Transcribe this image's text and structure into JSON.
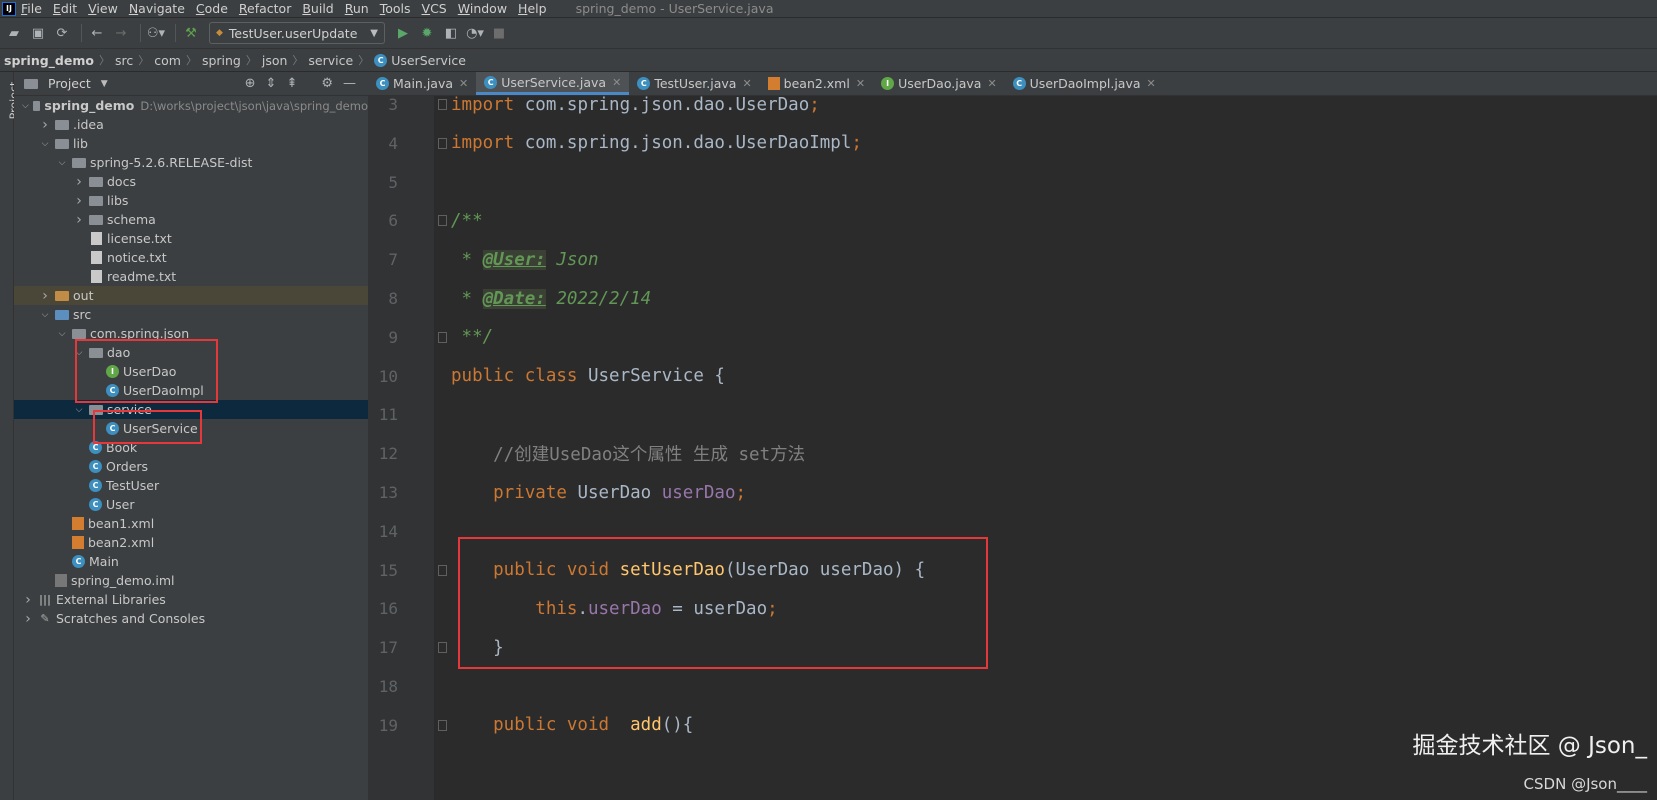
{
  "menubar": {
    "logo": "IJ",
    "items": [
      "File",
      "Edit",
      "View",
      "Navigate",
      "Code",
      "Refactor",
      "Build",
      "Run",
      "Tools",
      "VCS",
      "Window",
      "Help"
    ],
    "window_title": "spring_demo - UserService.java"
  },
  "toolbar": {
    "run_config": "TestUser.userUpdate"
  },
  "breadcrumb": [
    "spring_demo",
    "src",
    "com",
    "spring",
    "json",
    "service",
    "UserService"
  ],
  "side_stripe": {
    "label": "Project"
  },
  "project_panel": {
    "title": "Project",
    "project_path": "D:\\works\\project\\json\\java\\spring_demo",
    "tree": [
      {
        "label": "spring_demo",
        "depth": 0,
        "twisty": "open",
        "icon": "folder-module"
      },
      {
        "label": ".idea",
        "depth": 1,
        "twisty": "closed",
        "icon": "folder"
      },
      {
        "label": "lib",
        "depth": 1,
        "twisty": "open",
        "icon": "folder"
      },
      {
        "label": "spring-5.2.6.RELEASE-dist",
        "depth": 2,
        "twisty": "open",
        "icon": "folder"
      },
      {
        "label": "docs",
        "depth": 3,
        "twisty": "closed",
        "icon": "folder"
      },
      {
        "label": "libs",
        "depth": 3,
        "twisty": "closed",
        "icon": "folder"
      },
      {
        "label": "schema",
        "depth": 3,
        "twisty": "closed",
        "icon": "folder"
      },
      {
        "label": "license.txt",
        "depth": 3,
        "twisty": "none",
        "icon": "file"
      },
      {
        "label": "notice.txt",
        "depth": 3,
        "twisty": "none",
        "icon": "file"
      },
      {
        "label": "readme.txt",
        "depth": 3,
        "twisty": "none",
        "icon": "file"
      },
      {
        "label": "out",
        "depth": 1,
        "twisty": "closed",
        "icon": "folder-orange"
      },
      {
        "label": "src",
        "depth": 1,
        "twisty": "open",
        "icon": "folder-blue"
      },
      {
        "label": "com.spring.json",
        "depth": 2,
        "twisty": "open",
        "icon": "package"
      },
      {
        "label": "dao",
        "depth": 3,
        "twisty": "open",
        "icon": "package"
      },
      {
        "label": "UserDao",
        "depth": 4,
        "twisty": "none",
        "icon": "interface"
      },
      {
        "label": "UserDaoImpl",
        "depth": 4,
        "twisty": "none",
        "icon": "class"
      },
      {
        "label": "service",
        "depth": 3,
        "twisty": "open",
        "icon": "package"
      },
      {
        "label": "UserService",
        "depth": 4,
        "twisty": "none",
        "icon": "class"
      },
      {
        "label": "Book",
        "depth": 3,
        "twisty": "none",
        "icon": "class"
      },
      {
        "label": "Orders",
        "depth": 3,
        "twisty": "none",
        "icon": "class"
      },
      {
        "label": "TestUser",
        "depth": 3,
        "twisty": "none",
        "icon": "class"
      },
      {
        "label": "User",
        "depth": 3,
        "twisty": "none",
        "icon": "class"
      },
      {
        "label": "bean1.xml",
        "depth": 2,
        "twisty": "none",
        "icon": "xml"
      },
      {
        "label": "bean2.xml",
        "depth": 2,
        "twisty": "none",
        "icon": "xml"
      },
      {
        "label": "Main",
        "depth": 2,
        "twisty": "none",
        "icon": "class"
      },
      {
        "label": "spring_demo.iml",
        "depth": 1,
        "twisty": "none",
        "icon": "module"
      },
      {
        "label": "External Libraries",
        "depth": 0,
        "twisty": "closed",
        "icon": "library"
      },
      {
        "label": "Scratches and Consoles",
        "depth": 0,
        "twisty": "closed",
        "icon": "scratch"
      }
    ]
  },
  "editor_tabs": [
    {
      "label": "Main.java",
      "icon": "class",
      "active": false
    },
    {
      "label": "UserService.java",
      "icon": "class",
      "active": true
    },
    {
      "label": "TestUser.java",
      "icon": "class",
      "active": false
    },
    {
      "label": "bean2.xml",
      "icon": "xml",
      "active": false
    },
    {
      "label": "UserDao.java",
      "icon": "interface",
      "active": false
    },
    {
      "label": "UserDaoImpl.java",
      "icon": "class",
      "active": false
    }
  ],
  "code_lines": [
    {
      "n": "3",
      "tokens": [
        [
          "kw",
          "import "
        ],
        [
          "",
          "com.spring.json.dao.UserDao"
        ],
        [
          "kw",
          ";"
        ]
      ]
    },
    {
      "n": "4",
      "tokens": [
        [
          "kw",
          "import "
        ],
        [
          "",
          "com.spring.json.dao.UserDaoImpl"
        ],
        [
          "kw",
          ";"
        ]
      ]
    },
    {
      "n": "5",
      "tokens": []
    },
    {
      "n": "6",
      "tokens": [
        [
          "cm",
          "/**"
        ]
      ]
    },
    {
      "n": "7",
      "tokens": [
        [
          "cm",
          " * "
        ],
        [
          "tag",
          "@User:"
        ],
        [
          "cm",
          " Json"
        ]
      ]
    },
    {
      "n": "8",
      "tokens": [
        [
          "cm",
          " * "
        ],
        [
          "tag",
          "@Date:"
        ],
        [
          "cm",
          " 2022/2/14"
        ]
      ]
    },
    {
      "n": "9",
      "tokens": [
        [
          "cm",
          " **/"
        ]
      ]
    },
    {
      "n": "10",
      "tokens": [
        [
          "kw",
          "public class "
        ],
        [
          "",
          "UserService {"
        ]
      ]
    },
    {
      "n": "11",
      "tokens": []
    },
    {
      "n": "12",
      "tokens": [
        [
          "lc",
          "    //创建UseDao这个属性 生成 set方法"
        ]
      ]
    },
    {
      "n": "13",
      "tokens": [
        [
          "kw",
          "    private "
        ],
        [
          "",
          "UserDao "
        ],
        [
          "fld",
          "userDao"
        ],
        [
          "kw",
          ";"
        ]
      ]
    },
    {
      "n": "14",
      "tokens": []
    },
    {
      "n": "15",
      "tokens": [
        [
          "kw",
          "    public void "
        ],
        [
          "fn",
          "setUserDao"
        ],
        [
          "",
          "(UserDao userDao) {"
        ]
      ]
    },
    {
      "n": "16",
      "tokens": [
        [
          "kw",
          "        this"
        ],
        [
          "",
          "."
        ],
        [
          "fld",
          "userDao"
        ],
        [
          "",
          " = userDao"
        ],
        [
          "kw",
          ";"
        ]
      ]
    },
    {
      "n": "17",
      "tokens": [
        [
          "",
          "    }"
        ]
      ]
    },
    {
      "n": "18",
      "tokens": []
    },
    {
      "n": "19",
      "tokens": [
        [
          "kw",
          "    public void  "
        ],
        [
          "fn",
          "add"
        ],
        [
          "",
          "(){"
        ]
      ]
    }
  ],
  "watermark": {
    "line1": "掘金技术社区 @ Json_",
    "line2": "CSDN @Json____"
  }
}
